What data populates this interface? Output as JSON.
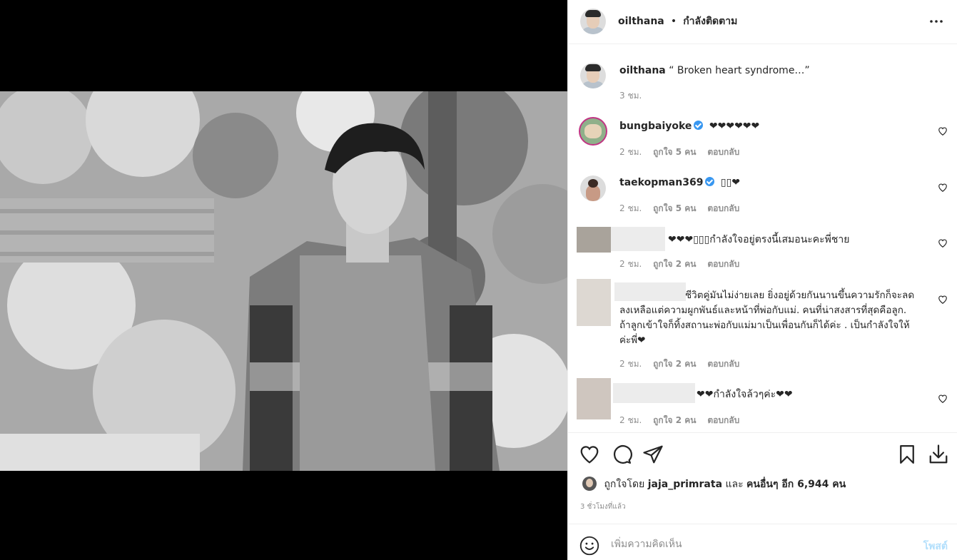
{
  "header": {
    "username": "oilthana",
    "separator": "•",
    "follow_status": "กำลังติดตาม"
  },
  "caption": {
    "username": "oilthana",
    "text": "“ Broken heart syndrome…”",
    "time": "3 ชม."
  },
  "comments": [
    {
      "username": "bungbaiyoke",
      "verified": true,
      "text": "❤❤❤❤❤❤",
      "time": "2 ชม.",
      "likes": "ถูกใจ 5 คน",
      "reply": "ตอบกลับ"
    },
    {
      "username": "taekopman369",
      "verified": true,
      "text": "▯▯❤",
      "time": "2 ชม.",
      "likes": "ถูกใจ 5 คน",
      "reply": "ตอบกลับ"
    },
    {
      "username": "",
      "verified": false,
      "text": "❤❤❤▯▯▯กำลังใจอยู่ตรงนี้เสมอนะคะพี่ชาย",
      "time": "2 ชม.",
      "likes": "ถูกใจ 2 คน",
      "reply": "ตอบกลับ"
    },
    {
      "username": "",
      "verified": false,
      "text": "ชีวิตคู่มันไม่ง่ายเลย ยิ่งอยู่ด้วยกันนานขึ้นความรักก็จะลดลงเหลือแต่ความผูกพันธ์และหน้าที่พ่อกับแม่. คนที่น่าสงสารที่สุดคือลูก. ถ้าลูกเข้าใจก็ทิ้งสถานะพ่อกับแม่มาเป็นเพื่อนกันก็ได้ค่ะ . เป็นกำลังใจให้ค่ะพี่❤",
      "time": "2 ชม.",
      "likes": "ถูกใจ 2 คน",
      "reply": "ตอบกลับ"
    },
    {
      "username": "",
      "verified": false,
      "text": "❤❤กำลังใจล้วๆค่ะ❤❤",
      "time": "2 ชม.",
      "likes": "ถูกใจ 2 คน",
      "reply": "ตอบกลับ"
    }
  ],
  "likes_summary": {
    "prefix": "ถูกใจโดย",
    "user": "jaja_primrata",
    "conj": "และ",
    "others": "คนอื่นๆ อีก 6,944 คน"
  },
  "posted_ago": "3 ชั่วโมงที่แล้ว",
  "add_comment": {
    "placeholder": "เพิ่มความคิดเห็น",
    "post_label": "โพสต์"
  },
  "icons": {
    "like": "heart-icon",
    "comment": "comment-icon",
    "share": "paper-plane-icon",
    "save": "bookmark-icon",
    "download": "download-icon",
    "more": "more-horizontal-icon",
    "emoji": "smiley-icon"
  },
  "colors": {
    "link_blue": "#b2dffc",
    "verified": "#3897f0",
    "muted": "#8e8e8e"
  }
}
